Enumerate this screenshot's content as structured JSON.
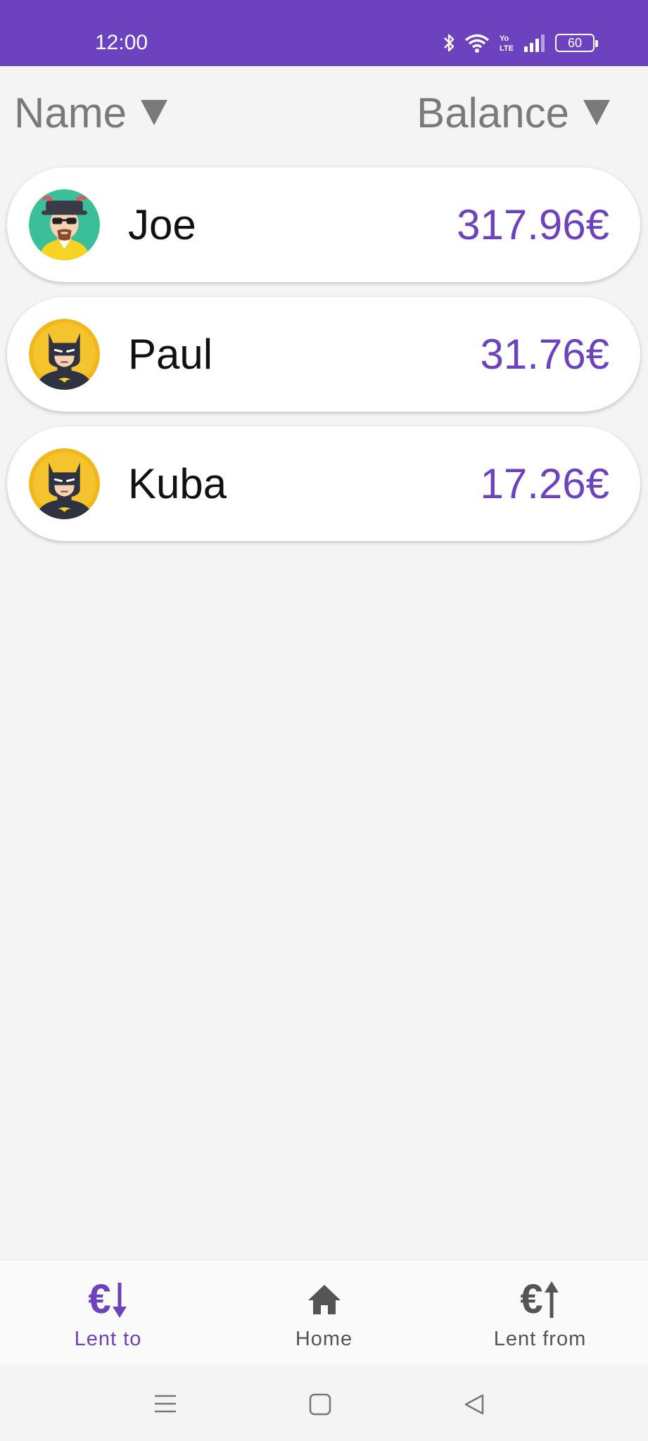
{
  "status_bar": {
    "time": "12:00",
    "battery": "60",
    "icons": [
      "bluetooth-icon",
      "wifi-icon",
      "volte-icon",
      "signal-icon",
      "battery-icon"
    ],
    "color": "#6c42bf"
  },
  "sort": {
    "name_label": "Name",
    "balance_label": "Balance",
    "indicator": "▼"
  },
  "people": [
    {
      "name": "Joe",
      "amount": "317.96€",
      "avatar": "heisenberg-avatar"
    },
    {
      "name": "Paul",
      "amount": "31.76€",
      "avatar": "batman-avatar"
    },
    {
      "name": "Kuba",
      "amount": "17.26€",
      "avatar": "batman-avatar"
    }
  ],
  "bottom_nav": {
    "items": [
      {
        "label": "Lent to",
        "icon": "euro-arrow-down-icon",
        "active": true
      },
      {
        "label": "Home",
        "icon": "home-icon",
        "active": false
      },
      {
        "label": "Lent from",
        "icon": "euro-arrow-up-icon",
        "active": false
      }
    ],
    "currency_symbol": "€"
  },
  "system_nav": [
    "menu-icon",
    "home-square-icon",
    "back-icon"
  ],
  "colors": {
    "accent": "#6c42bf",
    "text": "#111111",
    "muted": "#7a7a7a",
    "background": "#f4f4f4"
  }
}
